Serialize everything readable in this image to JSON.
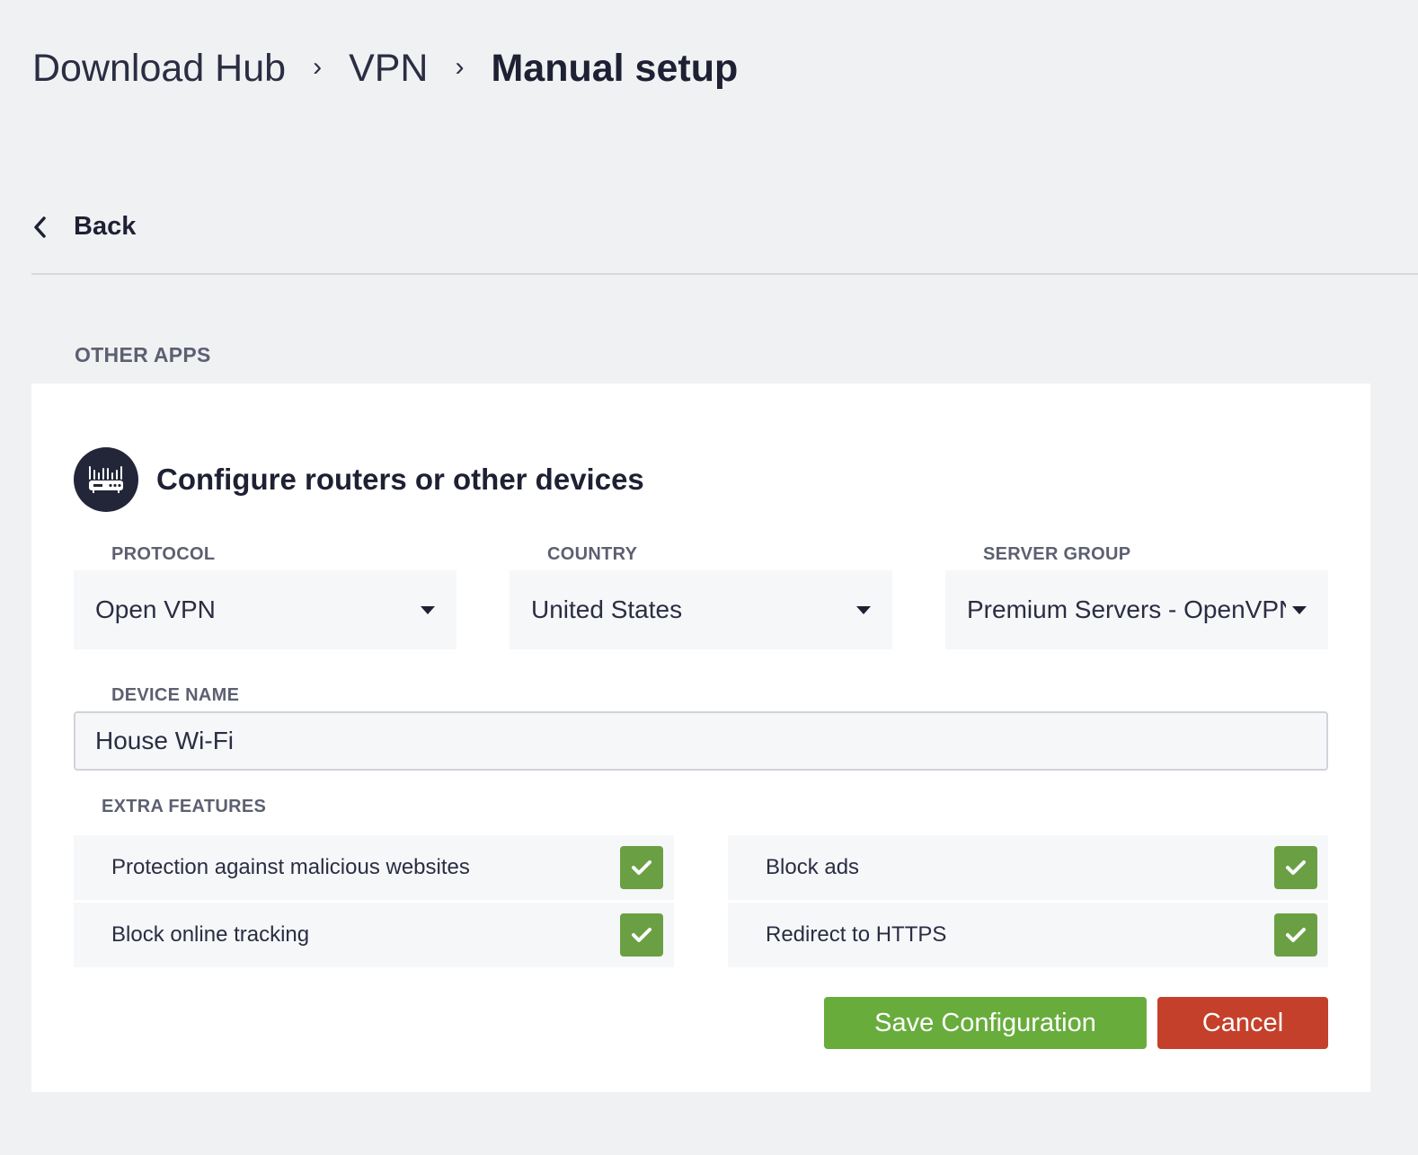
{
  "breadcrumb": {
    "items": [
      "Download Hub",
      "VPN"
    ],
    "current": "Manual setup",
    "separator": "›"
  },
  "back": {
    "label": "Back"
  },
  "section_title": "OTHER APPS",
  "card": {
    "title": "Configure routers or other devices",
    "icon": "router-icon"
  },
  "fields": {
    "protocol": {
      "label": "PROTOCOL",
      "value": "Open VPN"
    },
    "country": {
      "label": "COUNTRY",
      "value": "United States"
    },
    "server_group": {
      "label": "SERVER GROUP",
      "value": "Premium Servers - OpenVPN"
    },
    "device_name": {
      "label": "DEVICE NAME",
      "value": "House Wi-Fi"
    }
  },
  "extra_features": {
    "label": "EXTRA FEATURES",
    "items": [
      {
        "label": "Protection against malicious websites",
        "checked": true
      },
      {
        "label": "Block ads",
        "checked": true
      },
      {
        "label": "Block online tracking",
        "checked": true
      },
      {
        "label": "Redirect to HTTPS",
        "checked": true
      }
    ]
  },
  "actions": {
    "save_label": "Save Configuration",
    "cancel_label": "Cancel"
  },
  "colors": {
    "background": "#f0f1f3",
    "check": "#6aa043",
    "save": "#68ad3c",
    "cancel": "#c5402a",
    "icon_bg": "#232538"
  }
}
